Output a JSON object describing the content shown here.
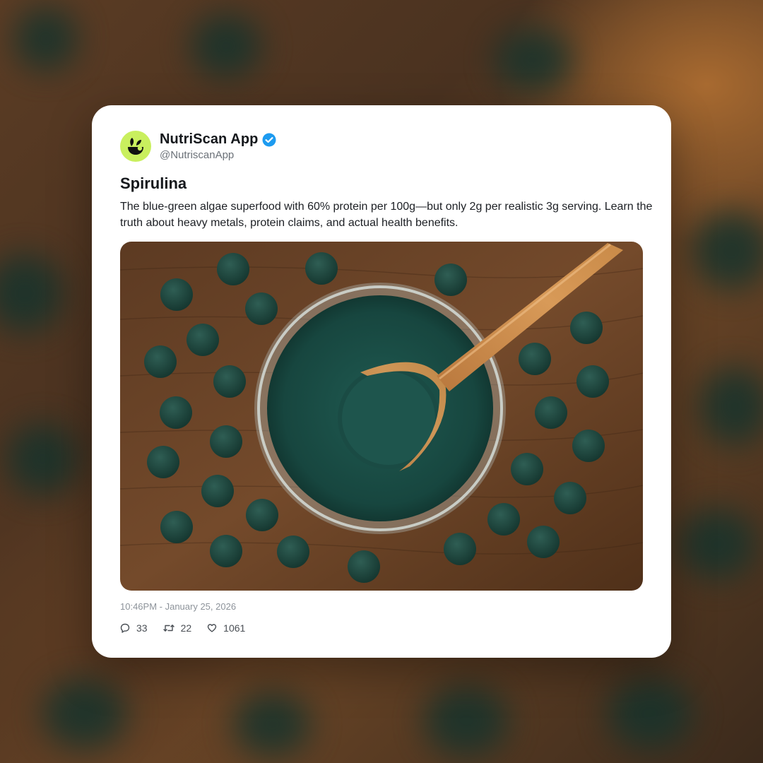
{
  "post": {
    "account": {
      "display_name": "NutriScan App",
      "handle": "@NutriscanApp",
      "verified": true,
      "avatar_icon": "leaf-logo-icon",
      "avatar_color": "#c9ef5e"
    },
    "title": "Spirulina",
    "description": "The blue-green algae superfood with 60% protein per 100g—but only 2g per realistic 3g serving. Learn the truth about heavy metals, protein claims, and actual health benefits.",
    "image_subject": "spirulina-powder-bowl-with-wooden-spoon-and-tablets",
    "timestamp": "10:46PM - January 25, 2026",
    "stats": {
      "replies": "33",
      "reposts": "22",
      "likes": "1061"
    }
  },
  "colors": {
    "verified_blue": "#1d9bf0",
    "spirulina_green": "#17463f",
    "wood_brown": "#6b4328"
  }
}
